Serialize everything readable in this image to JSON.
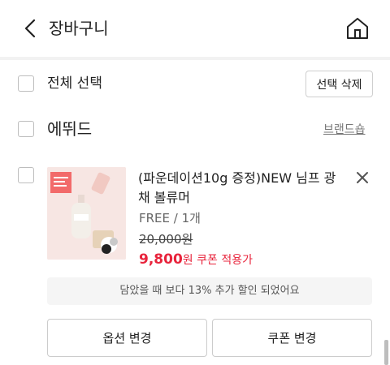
{
  "header": {
    "title": "장바구니",
    "back_icon": "chevron-left-icon",
    "home_icon": "home-icon"
  },
  "select_all": {
    "label": "전체 선택",
    "delete_button": "선택 삭제",
    "checked": false
  },
  "brand": {
    "name": "에뛰드",
    "shop_link": "브랜드숍",
    "checked": false
  },
  "item": {
    "checked": false,
    "title": "(파운데이션10g 증정)NEW 님프 광채 볼류머",
    "option": "FREE / 1개",
    "original_price": "20,000원",
    "sale_price": "9,800",
    "sale_note": "원 쿠폰 적용가",
    "remove_icon": "close-icon"
  },
  "discount_banner": "담았을 때 보다 13% 추가 할인 되었어요",
  "actions": {
    "change_option": "옵션 변경",
    "change_coupon": "쿠폰 변경"
  },
  "colors": {
    "accent_red": "#e8243c",
    "border_gray": "#cccccc",
    "banner_bg": "#f5f5f5",
    "product_bg": "#f7e6e3"
  }
}
